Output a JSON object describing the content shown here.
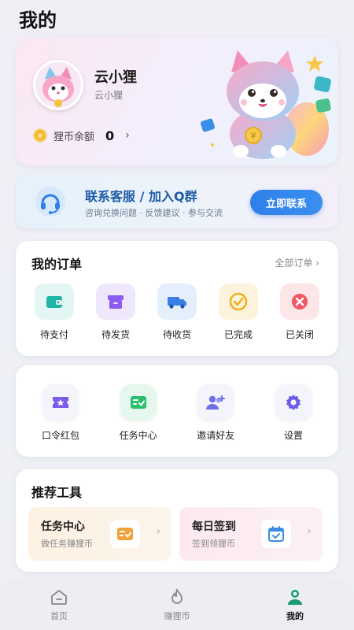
{
  "page": {
    "title": "我的"
  },
  "profile": {
    "name": "云小狸",
    "subtitle": "云小狸",
    "balance_label": "狸币余额",
    "balance_value": "0"
  },
  "service": {
    "title": "联系客服 / 加入Q群",
    "subtitle": "咨询兑换问题 · 反馈建议 · 参与交流",
    "button": "立即联系"
  },
  "orders": {
    "title": "我的订单",
    "all_link": "全部订单",
    "items": [
      {
        "label": "待支付",
        "icon": "wallet-icon",
        "color": "#1fb6a8"
      },
      {
        "label": "待发货",
        "icon": "package-icon",
        "color": "#8a5cf0"
      },
      {
        "label": "待收货",
        "icon": "truck-icon",
        "color": "#3a7fe6"
      },
      {
        "label": "已完成",
        "icon": "check-circle-icon",
        "color": "#f0b21e"
      },
      {
        "label": "已关闭",
        "icon": "close-circle-icon",
        "color": "#f05868"
      }
    ]
  },
  "services": {
    "items": [
      {
        "label": "口令红包",
        "icon": "ticket-icon",
        "color": "#7b5ce8"
      },
      {
        "label": "任务中心",
        "icon": "task-list-icon",
        "color": "#2cbf6e"
      },
      {
        "label": "邀请好友",
        "icon": "invite-user-icon",
        "color": "#6f6fe8"
      },
      {
        "label": "设置",
        "icon": "gear-icon",
        "color": "#6a5ce8"
      }
    ]
  },
  "tools": {
    "title": "推荐工具",
    "items": [
      {
        "title": "任务中心",
        "subtitle": "做任务赚狸币",
        "icon": "task-list-icon",
        "color": "#f0a13a"
      },
      {
        "title": "每日签到",
        "subtitle": "签到领狸币",
        "icon": "calendar-check-icon",
        "color": "#3a8fe6"
      }
    ]
  },
  "nav": {
    "items": [
      {
        "label": "首页",
        "icon": "home-icon",
        "active": false
      },
      {
        "label": "赚狸币",
        "icon": "flame-icon",
        "active": false
      },
      {
        "label": "我的",
        "icon": "user-icon",
        "active": true
      }
    ]
  }
}
